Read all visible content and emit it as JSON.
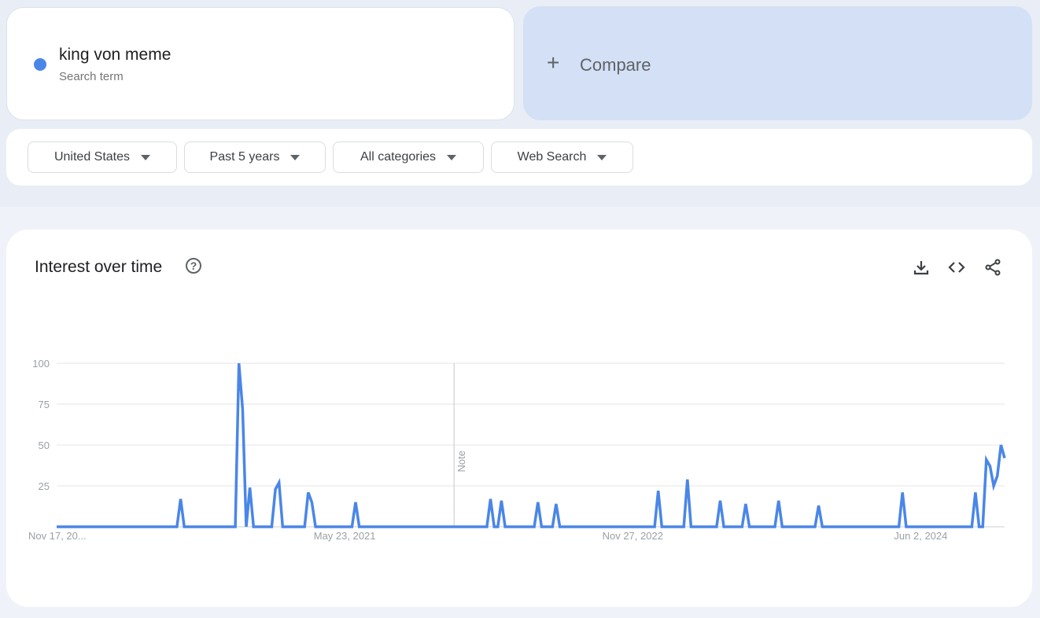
{
  "search_term": {
    "name": "king von meme",
    "subtitle": "Search term",
    "color": "#4a86e8"
  },
  "compare": {
    "label": "Compare",
    "icon": "plus-icon"
  },
  "filters": [
    {
      "label": "United States",
      "icon": "caret-down-icon"
    },
    {
      "label": "Past 5 years",
      "icon": "caret-down-icon"
    },
    {
      "label": "All categories",
      "icon": "caret-down-icon"
    },
    {
      "label": "Web Search",
      "icon": "caret-down-icon"
    }
  ],
  "chart_section": {
    "title": "Interest over time",
    "help_icon": "help-circle-icon",
    "actions": [
      "download-icon",
      "embed-code-icon",
      "share-icon"
    ],
    "help_glyph": "?"
  },
  "chart_data": {
    "type": "line",
    "title": "Interest over time",
    "xlabel": "",
    "ylabel": "",
    "ylim": [
      0,
      100
    ],
    "yticks": [
      100,
      75,
      50,
      25
    ],
    "grid": true,
    "x_unit": "week index (weekly, Nov 17, 2019 start)",
    "total_weeks": 261,
    "xtick_labels": [
      {
        "week": 0,
        "label": "Nov 17, 20..."
      },
      {
        "week": 79,
        "label": "May 23, 2021"
      },
      {
        "week": 158,
        "label": "Nov 27, 2022"
      },
      {
        "week": 237,
        "label": "Jun 2, 2024"
      }
    ],
    "annotations": [
      {
        "week": 109,
        "label": "Note"
      }
    ],
    "series": [
      {
        "name": "king von meme",
        "color": "#4a86e8",
        "default_value": 0,
        "points": [
          [
            34,
            17
          ],
          [
            50,
            100
          ],
          [
            51,
            72
          ],
          [
            53,
            24
          ],
          [
            60,
            23
          ],
          [
            61,
            27
          ],
          [
            69,
            21
          ],
          [
            70,
            15
          ],
          [
            82,
            15
          ],
          [
            119,
            17
          ],
          [
            122,
            16
          ],
          [
            132,
            15
          ],
          [
            137,
            14
          ],
          [
            165,
            22
          ],
          [
            173,
            29
          ],
          [
            182,
            16
          ],
          [
            189,
            14
          ],
          [
            198,
            16
          ],
          [
            209,
            13
          ],
          [
            232,
            21
          ],
          [
            252,
            21
          ],
          [
            253,
            0
          ],
          [
            255,
            41
          ],
          [
            256,
            37
          ],
          [
            257,
            25
          ],
          [
            258,
            31
          ],
          [
            259,
            50
          ],
          [
            260,
            42
          ]
        ]
      }
    ]
  }
}
